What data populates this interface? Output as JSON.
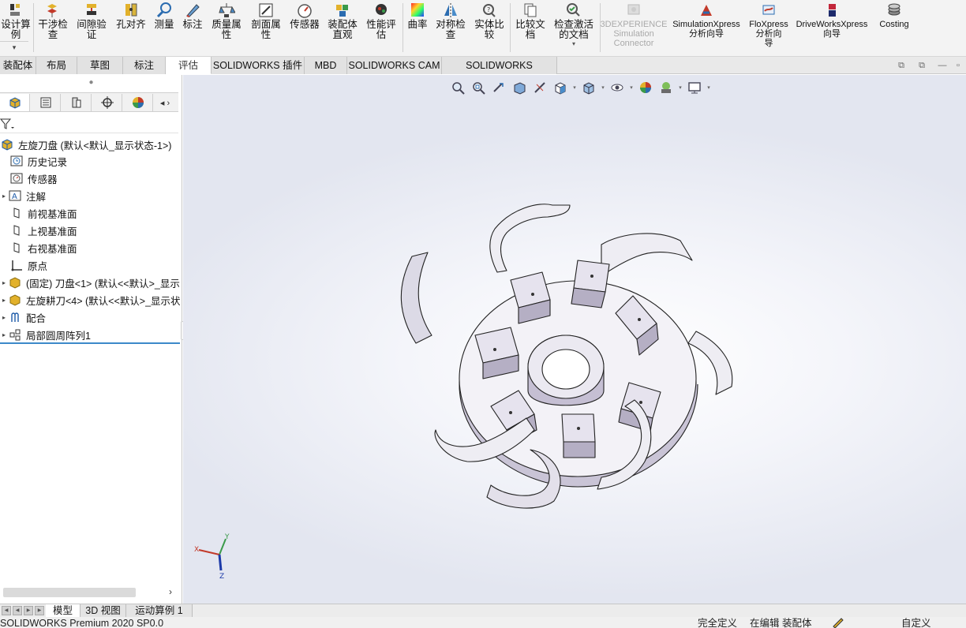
{
  "ribbon": {
    "buttons": [
      {
        "label": "设计算\n例",
        "icon": "design-study-icon"
      },
      {
        "label": "干涉检\n查",
        "icon": "interference-detection-icon"
      },
      {
        "label": "间隙验\n证",
        "icon": "clearance-verification-icon"
      },
      {
        "label": "孔对齐",
        "icon": "hole-alignment-icon"
      },
      {
        "label": "测量",
        "icon": "measure-icon"
      },
      {
        "label": "标注",
        "icon": "markup-icon"
      },
      {
        "label": "质量属\n性",
        "icon": "mass-properties-icon"
      },
      {
        "label": "剖面属\n性",
        "icon": "section-properties-icon"
      },
      {
        "label": "传感器",
        "icon": "sensor-icon"
      },
      {
        "label": "装配体\n直观",
        "icon": "assembly-visualization-icon"
      },
      {
        "label": "性能评\n估",
        "icon": "performance-evaluation-icon"
      },
      {
        "label": "曲率",
        "icon": "curvature-icon"
      },
      {
        "label": "对称检\n查",
        "icon": "symmetry-check-icon"
      },
      {
        "label": "实体比\n较",
        "icon": "compare-bodies-icon"
      },
      {
        "label": "比较文\n档",
        "icon": "compare-documents-icon"
      },
      {
        "label": "检查激活\n的文档",
        "icon": "check-active-document-icon"
      },
      {
        "label": "3DEXPERIENCE\nSimulation\nConnector",
        "icon": "3dexperience-simulation-icon"
      },
      {
        "label": "SimulationXpress\n分析向导",
        "icon": "simulationxpress-icon"
      },
      {
        "label": "FloXpress\n分析向\n导",
        "icon": "floxpress-icon"
      },
      {
        "label": "DriveWorksXpress\n向导",
        "icon": "driveworksxpress-icon"
      },
      {
        "label": "Costing",
        "icon": "costing-icon"
      }
    ],
    "left_dropdown": "▾"
  },
  "command_tabs": [
    "装配体",
    "布局",
    "草图",
    "标注",
    "评估",
    "SOLIDWORKS 插件",
    "MBD",
    "SOLIDWORKS CAM",
    "SOLIDWORKS Inspection"
  ],
  "active_command_tab": "评估",
  "feature_tree": {
    "root": "左旋刀盘  (默认<默认_显示状态-1>)",
    "items": [
      {
        "label": "历史记录",
        "icon": "history-icon"
      },
      {
        "label": "传感器",
        "icon": "sensors-folder-icon"
      },
      {
        "label": "注解",
        "icon": "annotations-icon"
      },
      {
        "label": "前视基准面",
        "icon": "plane-icon"
      },
      {
        "label": "上视基准面",
        "icon": "plane-icon"
      },
      {
        "label": "右视基准面",
        "icon": "plane-icon"
      },
      {
        "label": "原点",
        "icon": "origin-icon"
      },
      {
        "label": "(固定) 刀盘<1> (默认<<默认>_显示",
        "icon": "part-icon"
      },
      {
        "label": "左旋耕刀<4> (默认<<默认>_显示状",
        "icon": "part-icon"
      },
      {
        "label": "配合",
        "icon": "mates-icon"
      },
      {
        "label": "局部圆周阵列1",
        "icon": "circular-pattern-icon"
      }
    ]
  },
  "bottom_tabs": [
    "模型",
    "3D 视图",
    "运动算例 1"
  ],
  "active_bottom_tab": "模型",
  "status": {
    "product": "SOLIDWORKS Premium 2020 SP0.0",
    "definition": "完全定义",
    "editing": "在编辑 装配体",
    "units": "自定义"
  },
  "triad": {
    "x": "X",
    "y": "Y",
    "z": "Z"
  },
  "colors": {
    "accent": "#3c89c9",
    "ribbon_bg": "#f3f3f3",
    "model_face": "#e9e7f0",
    "model_shade": "#cbc6d6"
  }
}
